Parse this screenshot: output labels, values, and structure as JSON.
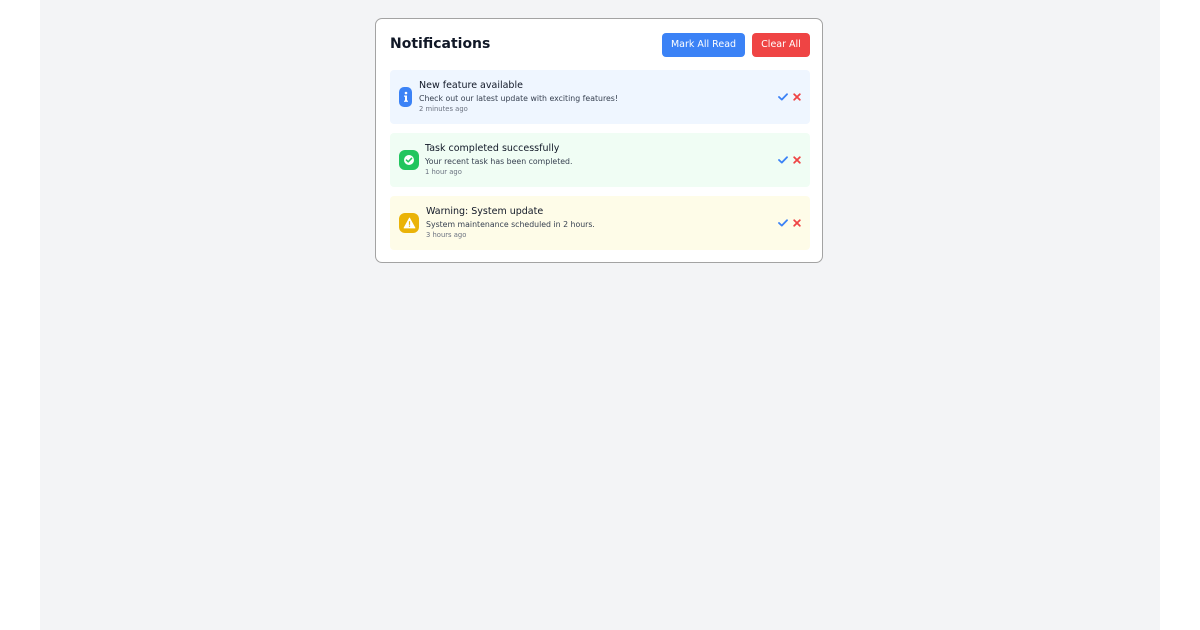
{
  "panel": {
    "title": "Notifications",
    "mark_all_read_label": "Mark All Read",
    "clear_all_label": "Clear All"
  },
  "notifications": [
    {
      "type": "info",
      "icon": "info-icon",
      "title": "New feature available",
      "message": "Check out our latest update with exciting features!",
      "time": "2 minutes ago",
      "bg_color": "#eff6ff",
      "icon_color": "#3b82f6"
    },
    {
      "type": "success",
      "icon": "check-circle-icon",
      "title": "Task completed successfully",
      "message": "Your recent task has been completed.",
      "time": "1 hour ago",
      "bg_color": "#f0fdf4",
      "icon_color": "#22c55e"
    },
    {
      "type": "warning",
      "icon": "warning-icon",
      "title": "Warning: System update",
      "message": "System maintenance scheduled in 2 hours.",
      "time": "3 hours ago",
      "bg_color": "#fefce8",
      "icon_color": "#eab308"
    }
  ],
  "colors": {
    "primary": "#3b82f6",
    "danger": "#ef4444",
    "page_bg": "#f3f4f6"
  }
}
